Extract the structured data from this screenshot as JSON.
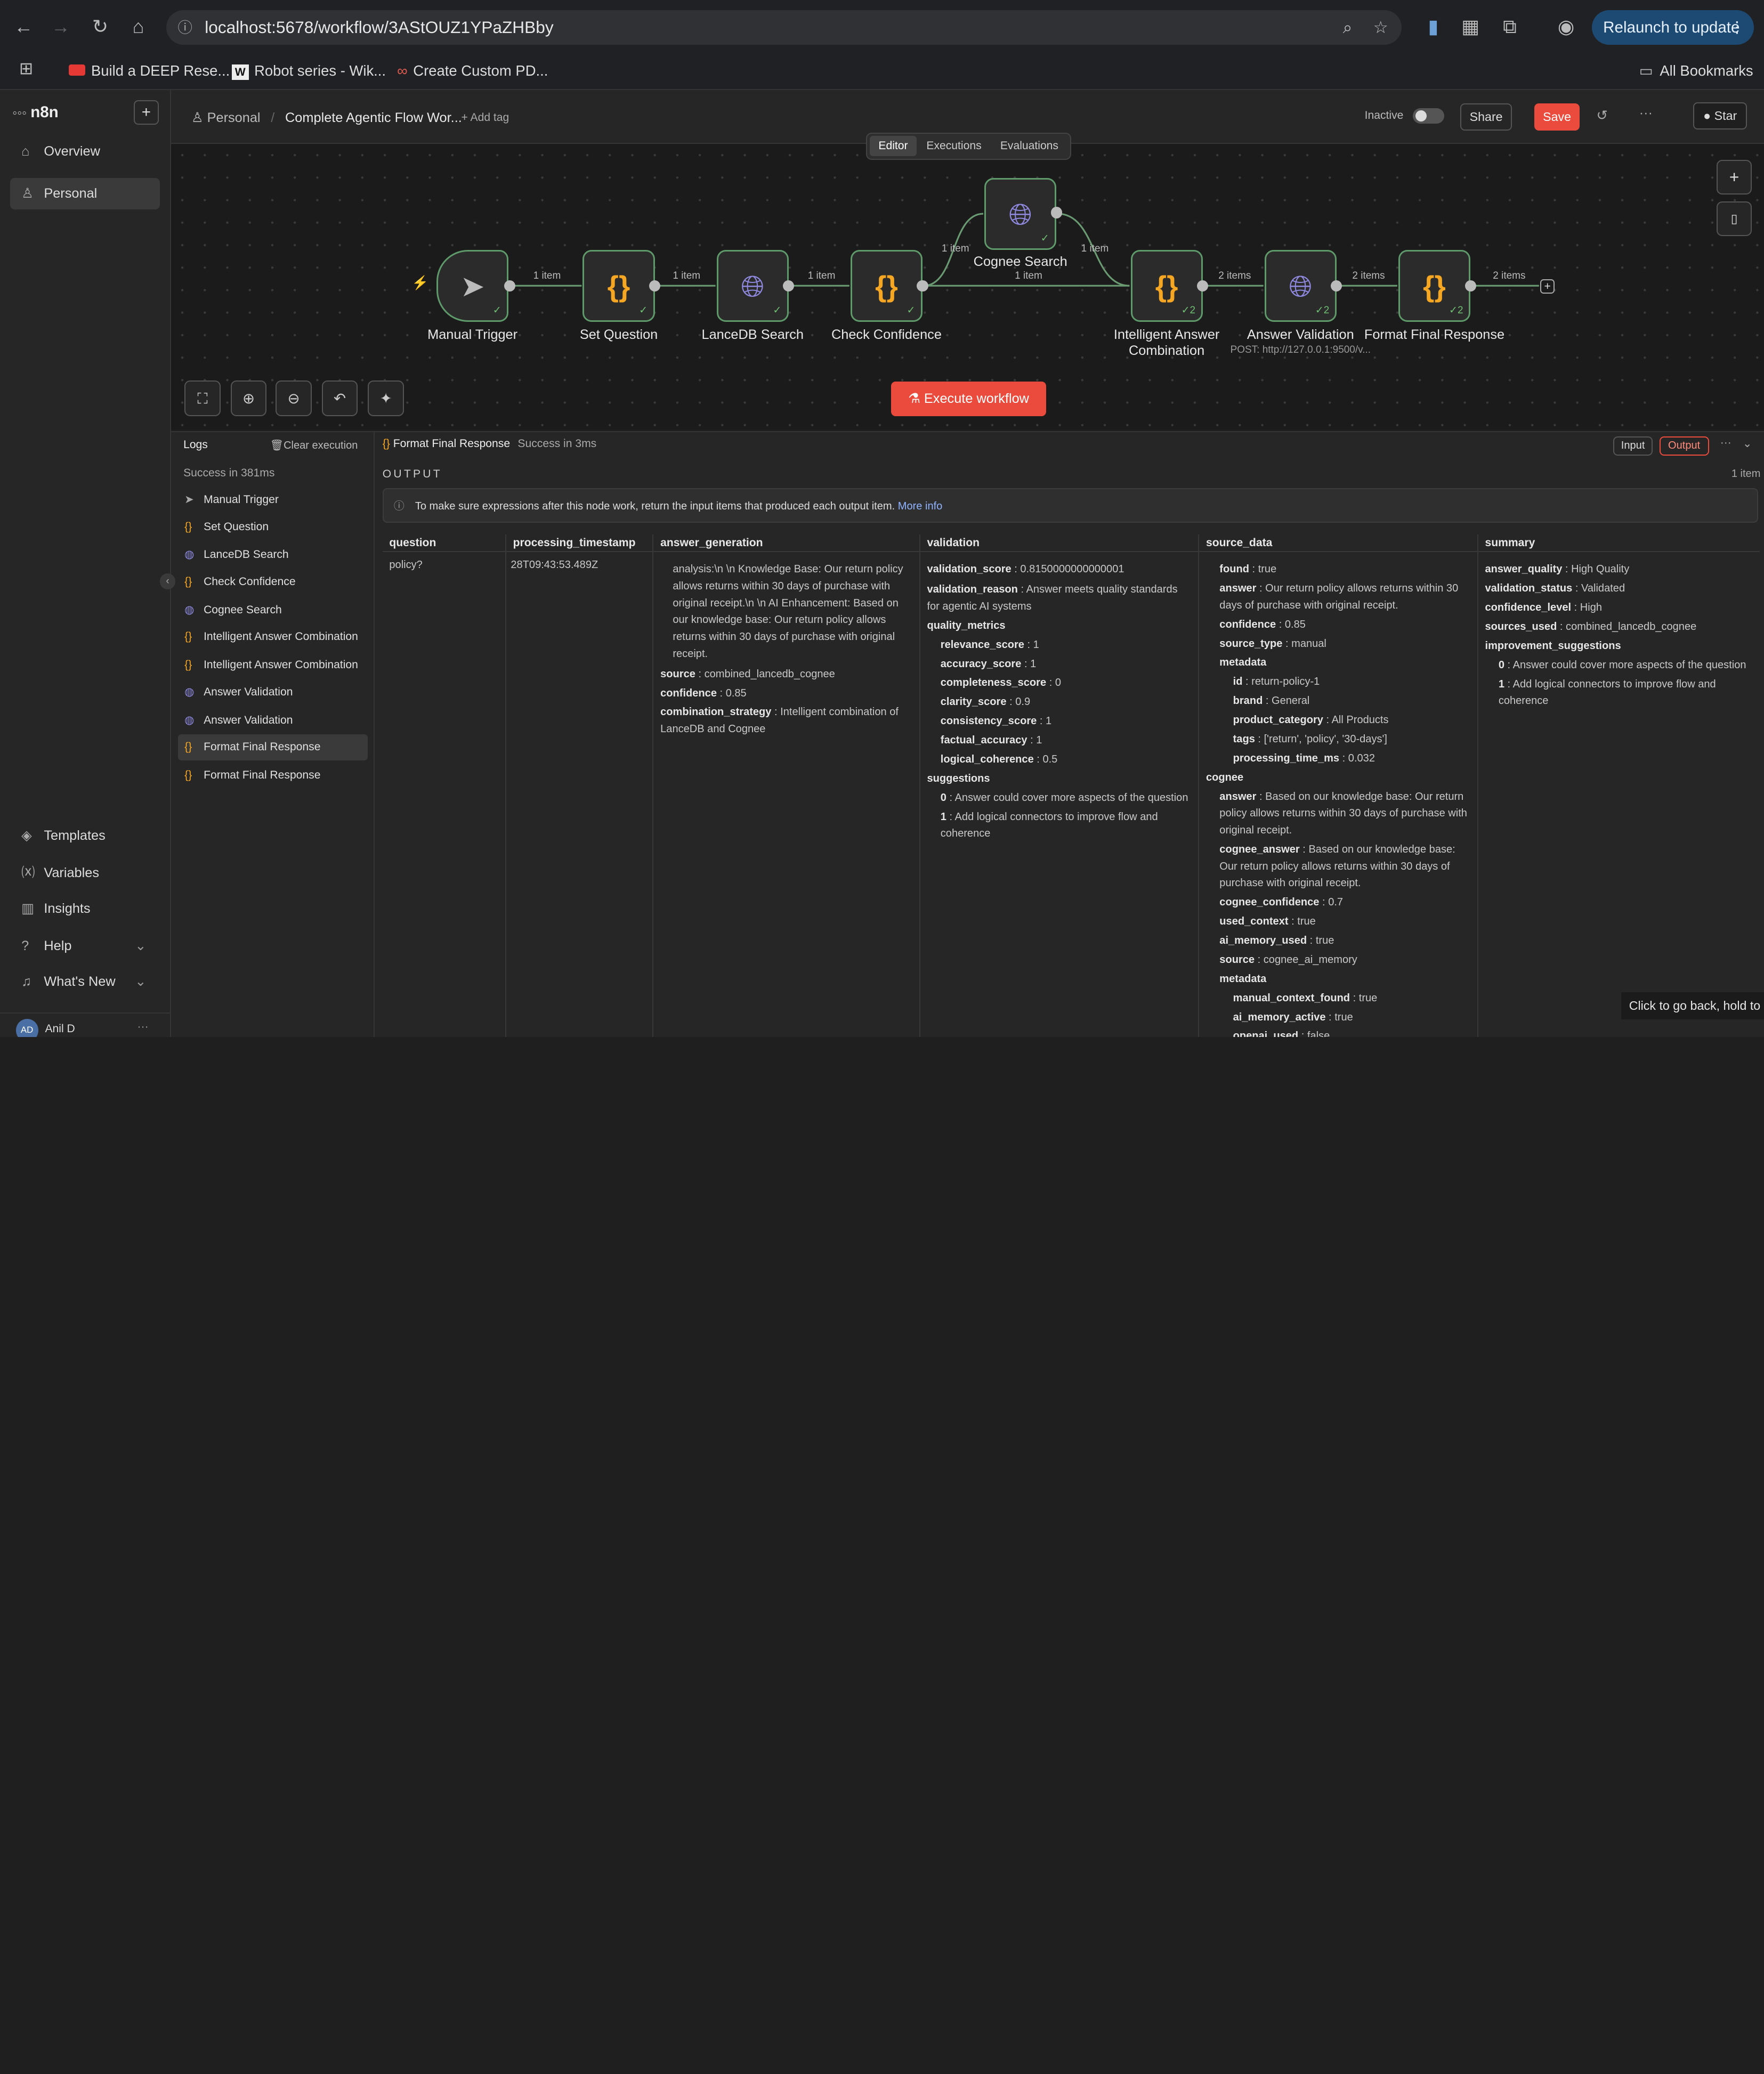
{
  "browser": {
    "url": "localhost:5678/workflow/3AStOUZ1YPaZHBby",
    "relaunch_label": "Relaunch to update",
    "bookmarks": [
      "Build a DEEP Rese...",
      "Robot series - Wik...",
      "Create Custom PD..."
    ],
    "all_bookmarks_label": "All Bookmarks"
  },
  "app": {
    "brand": "n8n",
    "sidebar": {
      "top_items": [
        {
          "label": "Overview"
        },
        {
          "label": "Personal"
        }
      ],
      "bottom_items": [
        {
          "label": "Templates"
        },
        {
          "label": "Variables"
        },
        {
          "label": "Insights"
        },
        {
          "label": "Help"
        },
        {
          "label": "What's New"
        }
      ],
      "user": {
        "initials": "AD",
        "name": "Anil D"
      }
    },
    "header": {
      "project": "Personal",
      "workflow_name": "Complete Agentic Flow Wor...",
      "add_tag": "+ Add tag",
      "inactive_label": "Inactive",
      "share_label": "Share",
      "save_label": "Save",
      "star_label": "Star"
    },
    "tabs": [
      "Editor",
      "Executions",
      "Evaluations"
    ],
    "active_tab": "Editor"
  },
  "canvas": {
    "nodes": [
      {
        "name": "Manual Trigger",
        "icon": "cursor-icon"
      },
      {
        "name": "Set Question",
        "icon": "braces-icon"
      },
      {
        "name": "LanceDB Search",
        "icon": "globe-icon"
      },
      {
        "name": "Check Confidence",
        "icon": "braces-icon"
      },
      {
        "name": "Cognee Search",
        "icon": "globe-icon"
      },
      {
        "name": "Intelligent Answer",
        "name2": "Combination",
        "icon": "braces-icon",
        "count": "2"
      },
      {
        "name": "Answer Validation",
        "icon": "globe-icon",
        "count": "2",
        "sub": "POST: http://127.0.0.1:9500/v..."
      },
      {
        "name": "Format Final Response",
        "icon": "braces-icon",
        "count": "2"
      }
    ],
    "edge_labels": {
      "e1": "1 item",
      "e2": "1 item",
      "e3": "1 item",
      "e4": "1 item",
      "e5": "1 item",
      "e6": "1 item",
      "e7": "2 items",
      "e8": "2 items",
      "e9": "2 items"
    },
    "execute_label": "Execute workflow"
  },
  "logs": {
    "title": "Logs",
    "clear_label": "Clear execution",
    "status": "Success in 381ms",
    "items": [
      {
        "label": "Manual Trigger",
        "icon": "cursor-icon"
      },
      {
        "label": "Set Question",
        "icon": "braces-icon"
      },
      {
        "label": "LanceDB Search",
        "icon": "globe-icon"
      },
      {
        "label": "Check Confidence",
        "icon": "braces-icon"
      },
      {
        "label": "Cognee Search",
        "icon": "globe-icon"
      },
      {
        "label": "Intelligent Answer Combination",
        "icon": "braces-icon"
      },
      {
        "label": "Intelligent Answer Combination",
        "icon": "braces-icon"
      },
      {
        "label": "Answer Validation",
        "icon": "globe-icon"
      },
      {
        "label": "Answer Validation",
        "icon": "globe-icon"
      },
      {
        "label": "Format Final Response",
        "icon": "braces-icon",
        "selected": true
      },
      {
        "label": "Format Final Response",
        "icon": "braces-icon"
      }
    ]
  },
  "output": {
    "node_name": "Format Final Response",
    "status": "Success in 3ms",
    "input_label": "Input",
    "output_label": "Output",
    "section_label": "OUTPUT",
    "count": "1 item",
    "notice": "To make sure expressions after this node work, return the input items that produced each output item.",
    "more_info": "More info",
    "columns": [
      "question",
      "processing_timestamp",
      "answer_generation",
      "validation",
      "source_data",
      "summary"
    ],
    "question_value": "policy?",
    "timestamp_value": "28T09:43:53.489Z",
    "answer_generation": {
      "text": "analysis:\\n \\n Knowledge Base: Our return policy allows returns within 30 days of purchase with original receipt.\\n \\n AI Enhancement: Based on our knowledge base: Our return policy allows returns within 30 days of purchase with original receipt.",
      "source_key": "source",
      "source_val": "combined_lancedb_cognee",
      "confidence_key": "confidence",
      "confidence_val": "0.85",
      "strategy_key": "combination_strategy",
      "strategy_val": "Intelligent combination of LanceDB and Cognee"
    },
    "validation": {
      "score_key": "validation_score",
      "score_val": "0.8150000000000001",
      "reason_key": "validation_reason",
      "reason_val": "Answer meets quality standards for agentic AI systems",
      "qm_key": "quality_metrics",
      "metrics": [
        {
          "k": "relevance_score",
          "v": "1"
        },
        {
          "k": "accuracy_score",
          "v": "1"
        },
        {
          "k": "completeness_score",
          "v": "0"
        },
        {
          "k": "clarity_score",
          "v": "0.9"
        },
        {
          "k": "consistency_score",
          "v": "1"
        },
        {
          "k": "factual_accuracy",
          "v": "1"
        },
        {
          "k": "logical_coherence",
          "v": "0.5"
        }
      ],
      "sugg_key": "suggestions",
      "s0": "Answer could cover more aspects of the question",
      "s1": "Add logical connectors to improve flow and coherence"
    },
    "source_data": {
      "found": "true",
      "answer": "Our return policy allows returns within 30 days of purchase with original receipt.",
      "confidence": "0.85",
      "source_type": "manual",
      "id": "return-policy-1",
      "brand": "General",
      "product_category": "All Products",
      "tags": "['return', 'policy', '30-days']",
      "processing_time_ms": "0.032",
      "cognee_answer_a": "Based on our knowledge base: Our return policy allows returns within 30 days of purchase with original receipt.",
      "cognee_answer_b": "Based on our knowledge base: Our return policy allows returns within 30 days of purchase with original receipt.",
      "cognee_confidence": "0.7",
      "used_context": "true",
      "ai_memory_used": "true",
      "source": "cognee_ai_memory",
      "manual_context_found": "true",
      "ai_memory_active": "true",
      "openai_used": "false"
    },
    "summary": {
      "answer_quality": "High Quality",
      "validation_status": "Validated",
      "confidence_level": "High",
      "sources_used": "combined_lancedb_cognee",
      "s0": "Answer could cover more aspects of the question",
      "s1": "Add logical connectors to improve flow and coherence"
    }
  },
  "tooltip": "Click to go back, hold to"
}
